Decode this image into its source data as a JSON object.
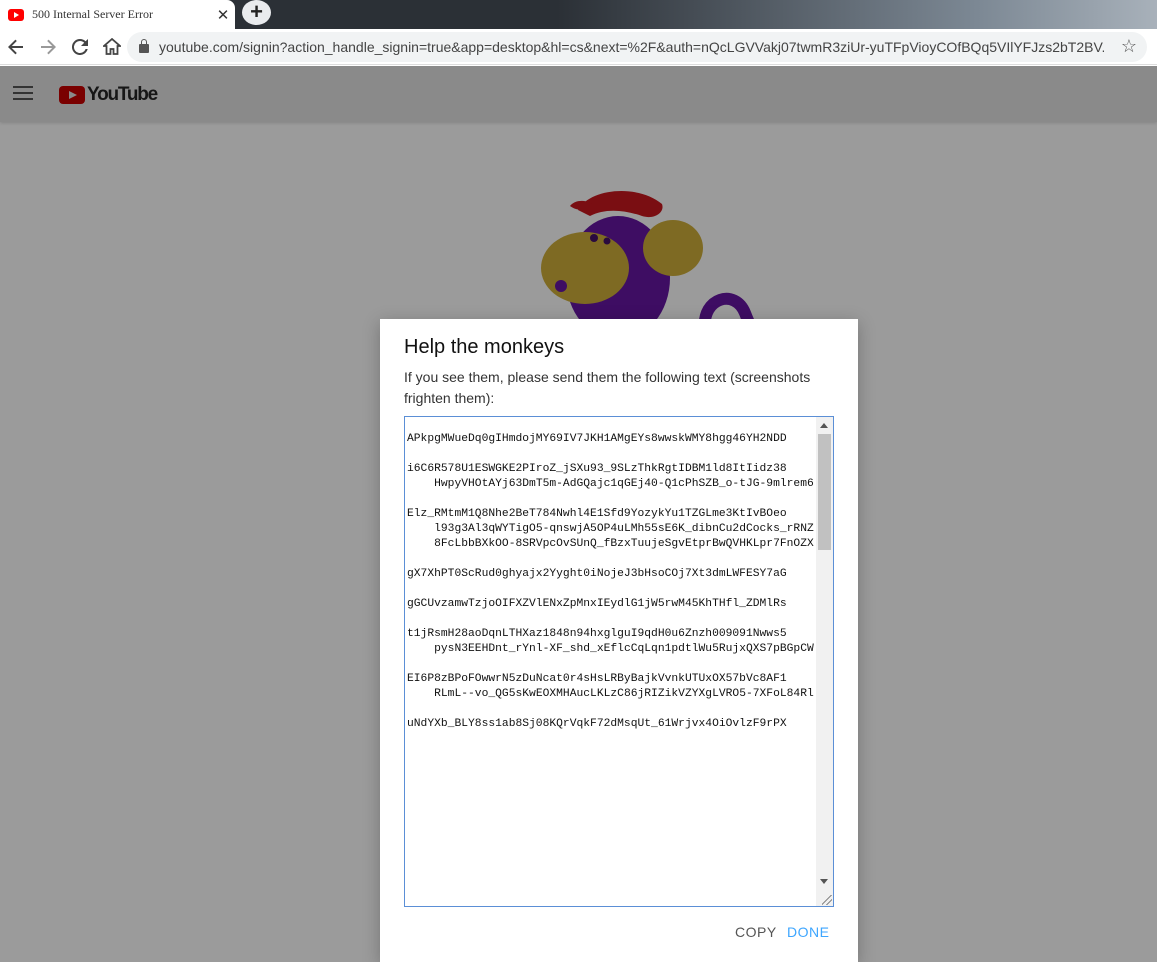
{
  "browser": {
    "tab_title": "500 Internal Server Error",
    "tab_close": "✕",
    "new_tab": "+",
    "url": "youtube.com/signin?action_handle_signin=true&app=desktop&hl=cs&next=%2F&auth=nQcLGVVakj07twmR3ziUr-yuTFpVioyCOfBQq5VIlYFJzs2bT2BV..."
  },
  "masthead": {
    "logo_text": "YouTube"
  },
  "dialog": {
    "title": "Help the monkeys",
    "description": "If you see them, please send them the following text (screenshots frighten them):",
    "error_text": "\nAPkpgMWueDq0gIHmdojMY69IV7JKH1AMgEYs8wwskWMY8hgg46YH2NDD\n\ni6C6R578U1ESWGKE2PIroZ_jSXu93_9SLzThkRgtIDBM1ld8ItIidz38\n    HwpyVHOtAYj63DmT5m-AdGQajc1qGEj40-Q1cPhSZB_o-tJG-9mlrem6\n\nElz_RMtmM1Q8Nhe2BeT784Nwhl4E1Sfd9YozykYu1TZGLme3KtIvBOeo\n    l93g3Al3qWYTigO5-qnswjA5OP4uLMh55sE6K_dibnCu2dCocks_rRNZ\n    8FcLbbBXkOO-8SRVpcOvSUnQ_fBzxTuujeSgvEtprBwQVHKLpr7FnOZX\n\ngX7XhPT0ScRud0ghyajx2Yyght0iNojeJ3bHsoCOj7Xt3dmLWFESY7aG\n\ngGCUvzamwTzjoOIFXZVlENxZpMnxIEydlG1jW5rwM45KhTHfl_ZDMlRs\n\nt1jRsmH28aoDqnLTHXaz1848n94hxglguI9qdH0u6Znzh009091Nwws5\n    pysN3EEHDnt_rYnl-XF_shd_xEflcCqLqn1pdtlWu5RujxQXS7pBGpCW\n\nEI6P8zBPoFOwwrN5zDuNcat0r4sHsLRByBajkVvnkUTUxOX57bVc8AF1\n    RLmL--vo_QG5sKwEOXMHAucLKLzC86jRIZikVZYXgLVRO5-7XFoL84Rl\n\nuNdYXb_BLY8ss1ab8Sj08KQrVqkF72dMsqUt_61Wrjvx4OiOvlzF9rPX",
    "copy_label": "COPY",
    "done_label": "DONE"
  }
}
